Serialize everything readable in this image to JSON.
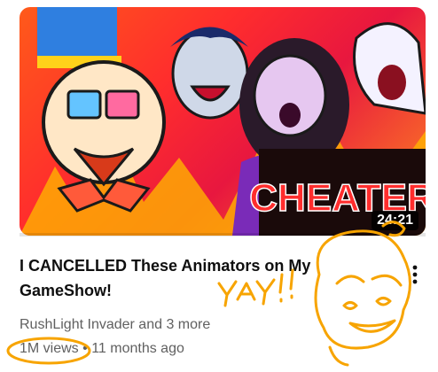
{
  "video": {
    "duration": "24:21",
    "title": "I CANCELLED These Animators on My GameShow!",
    "channel": "RushLight Invader and 3 more",
    "views": "1M views",
    "separator": "•",
    "age": "11 months ago",
    "watch_progress": 0.0
  },
  "thumbnail": {
    "caption": "CHEATER"
  },
  "annotation": {
    "scribble_text": "YAY!!"
  },
  "colors": {
    "accent": "#ff0000",
    "annotation": "#f7a400",
    "title": "#0f0f0f",
    "meta": "#606060"
  }
}
